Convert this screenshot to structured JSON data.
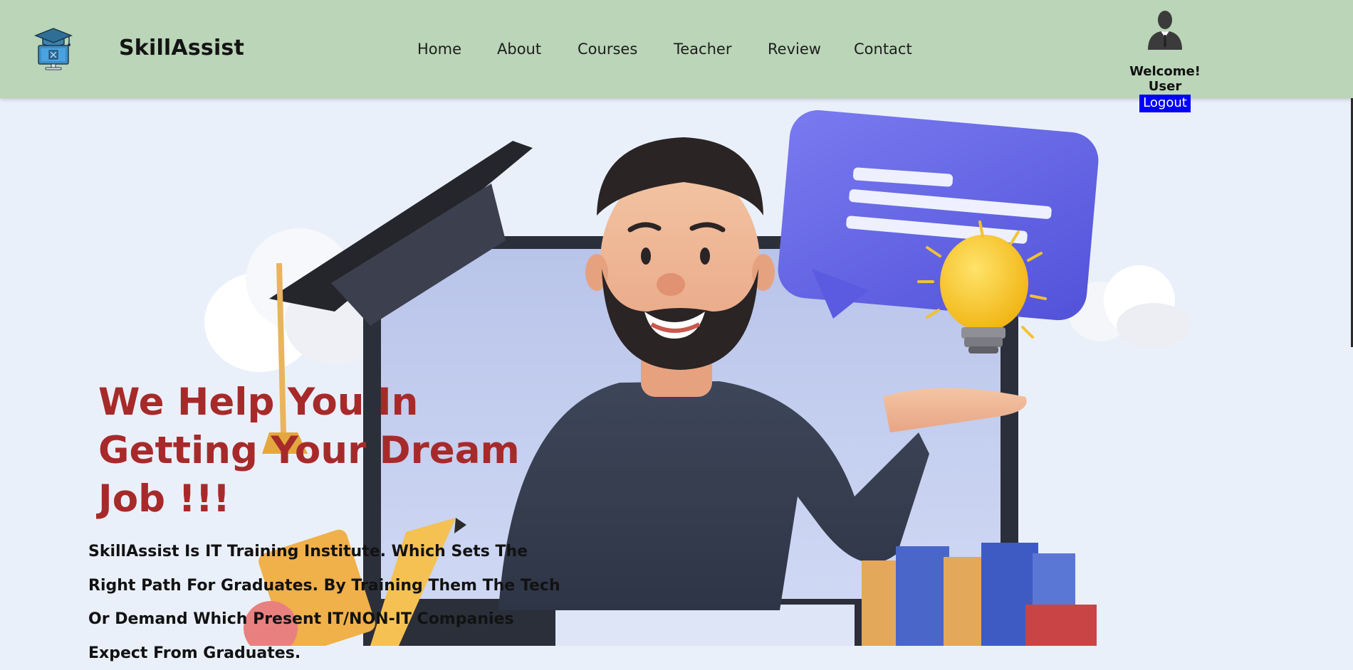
{
  "brand": {
    "name": "SkillAssist",
    "logo_icon": "graduation-monitor-icon"
  },
  "nav": {
    "items": [
      {
        "label": "Home"
      },
      {
        "label": "About"
      },
      {
        "label": "Courses"
      },
      {
        "label": "Teacher"
      },
      {
        "label": "Review"
      },
      {
        "label": "Contact"
      }
    ]
  },
  "user": {
    "avatar_icon": "businessman-avatar-icon",
    "welcome_text": "Welcome! User",
    "logout_label": "Logout"
  },
  "hero": {
    "headline_lines": [
      "We Help You In",
      "Getting Your Dream",
      "Job !!!"
    ],
    "description_lines": [
      "SkillAssist Is IT Training Institute. Which Sets The",
      "Right Path For Graduates. By Training Them The Tech",
      "Or Demand Which Present IT/NON-IT Companies",
      "Expect From Graduates."
    ],
    "illustration": "teacher-with-laptop-graduation-cap-lightbulb-illustration"
  },
  "colors": {
    "header_bg": "#bad5b7",
    "page_bg": "#eaf0fa",
    "headline": "#a72a2a",
    "logout_bg": "#0000ff"
  }
}
